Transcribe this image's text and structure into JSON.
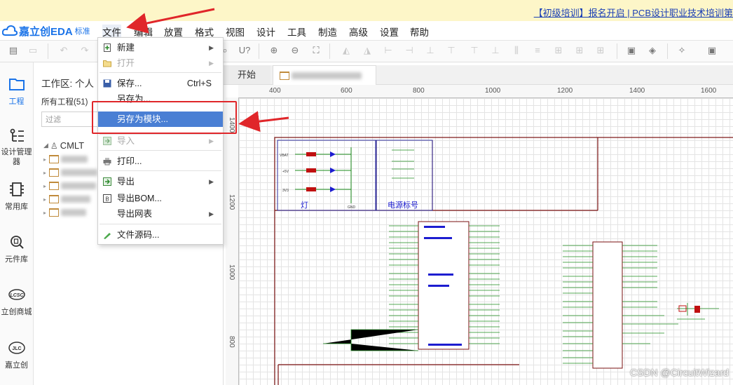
{
  "banner": {
    "text": "【初级培训】报名开启 | PCB设计职业技术培训第"
  },
  "app": {
    "logo_text": "嘉立创EDA",
    "logo_sub": "标准"
  },
  "menu": [
    "文件",
    "编辑",
    "放置",
    "格式",
    "视图",
    "设计",
    "工具",
    "制造",
    "高级",
    "设置",
    "帮助"
  ],
  "rail": [
    {
      "label": "工程",
      "icon": "folder-icon"
    },
    {
      "label": "设计管理器",
      "icon": "tree-list-icon"
    },
    {
      "label": "常用库",
      "icon": "chip-icon"
    },
    {
      "label": "元件库",
      "icon": "component-search-icon"
    },
    {
      "label": "立创商城",
      "icon": "lcsc-icon"
    },
    {
      "label": "嘉立创",
      "icon": "jlc-icon"
    }
  ],
  "panel": {
    "workspace": "工作区: 个人",
    "all_projects": "所有工程(51)",
    "filter_placeholder": "过滤",
    "root": "CMLT"
  },
  "tabs": {
    "start": "开始"
  },
  "rulers": {
    "h": [
      "400",
      "600",
      "800",
      "1000",
      "1200",
      "1400",
      "1600"
    ],
    "v": [
      "1400",
      "1200",
      "1000",
      "800"
    ]
  },
  "file_menu": {
    "items": [
      {
        "label": "新建",
        "shortcut": "",
        "submenu": true,
        "disabled": false,
        "icon": "new-file-icon"
      },
      {
        "label": "打开",
        "shortcut": "",
        "submenu": true,
        "disabled": true,
        "icon": "open-folder-icon"
      },
      {
        "label": "保存...",
        "shortcut": "Ctrl+S",
        "submenu": false,
        "disabled": false,
        "icon": "save-icon"
      },
      {
        "label": "另存为...",
        "shortcut": "",
        "submenu": false,
        "disabled": false,
        "icon": ""
      },
      {
        "label": "另存为模块...",
        "shortcut": "",
        "submenu": false,
        "disabled": false,
        "highlighted": true,
        "icon": ""
      },
      {
        "label": "导入",
        "shortcut": "",
        "submenu": true,
        "disabled": true,
        "icon": "import-icon"
      },
      {
        "label": "打印...",
        "shortcut": "",
        "submenu": false,
        "disabled": false,
        "icon": "print-icon"
      },
      {
        "label": "导出",
        "shortcut": "",
        "submenu": true,
        "disabled": false,
        "icon": "export-icon"
      },
      {
        "label": "导出BOM...",
        "shortcut": "",
        "submenu": false,
        "disabled": false,
        "icon": "bom-icon"
      },
      {
        "label": "导出网表",
        "shortcut": "",
        "submenu": true,
        "disabled": false,
        "icon": ""
      },
      {
        "label": "文件源码...",
        "shortcut": "",
        "submenu": false,
        "disabled": false,
        "icon": "source-code-icon"
      }
    ]
  },
  "schematic": {
    "block1_label": "灯",
    "block2_label": "电源标号",
    "net_labels": [
      "VBAT",
      "+5V",
      "3V3",
      "GND"
    ]
  },
  "colors": {
    "accent": "#1a73e8",
    "highlight": "#4a7fd4",
    "annotation_red": "#e0262a",
    "banner_bg": "#fdf6c8"
  },
  "watermark": "CSDN @CircuitWizard"
}
